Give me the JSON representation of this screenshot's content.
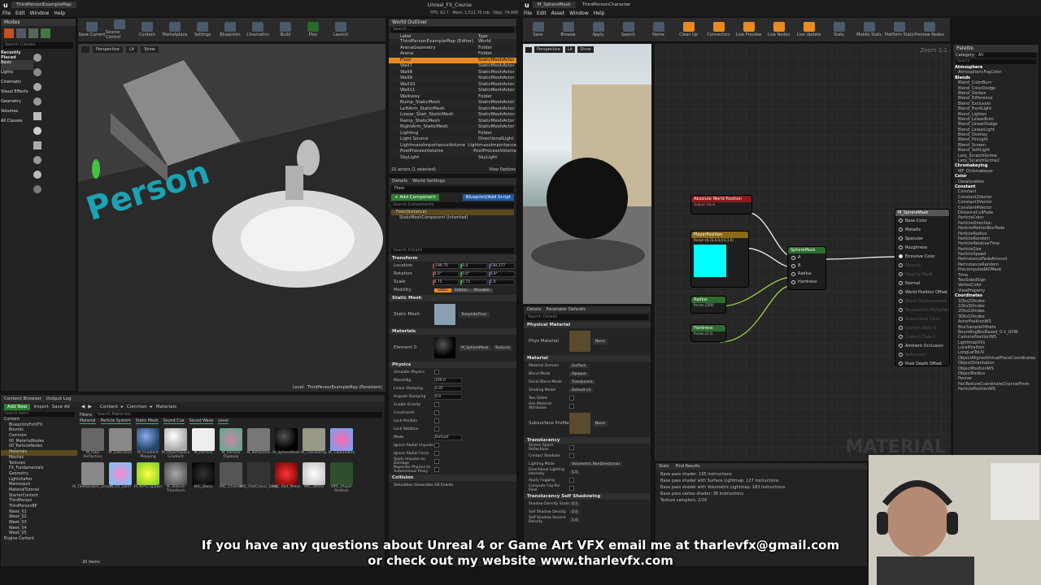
{
  "left_window": {
    "tab": "ThirdPersonExampleMap",
    "app_title": "Unreal_FX_Course",
    "menu": [
      "File",
      "Edit",
      "Window",
      "Help"
    ],
    "stats": "FPS: 62.7 · Mem: 1,511.70 mb · Objs: 74,999",
    "modes_label": "Modes",
    "toolbar": [
      "Save Current",
      "Source Control",
      "Content",
      "Marketplace",
      "Settings",
      "Blueprints",
      "Cinematics",
      "Build",
      "Play",
      "Launch"
    ],
    "search_placeholder": "Search Classes",
    "categories": [
      "Recently Placed",
      "Basic",
      "Lights",
      "Cinematic",
      "Visual Effects",
      "Geometry",
      "Volumes",
      "All Classes"
    ],
    "viewport": {
      "perspective": "Perspective",
      "lit": "Lit",
      "show": "Show",
      "level_label": "Level:",
      "level_name": "ThirdPersonExampleMap (Persistent)",
      "floor_text": "Person"
    },
    "outliner": {
      "title": "World Outliner",
      "search": "Search...",
      "col_label": "Label",
      "col_type": "Type",
      "rows": [
        [
          "ThirdPersonExampleMap (Editor)",
          "World"
        ],
        [
          "ArenaGeometry",
          "Folder"
        ],
        [
          "Arena",
          "Folder"
        ],
        [
          "Floor",
          "StaticMeshActor"
        ],
        [
          "Wall7",
          "StaticMeshActor"
        ],
        [
          "Wall8",
          "StaticMeshActor"
        ],
        [
          "Wall9",
          "StaticMeshActor"
        ],
        [
          "Wall10",
          "StaticMeshActor"
        ],
        [
          "Wall11",
          "StaticMeshActor"
        ],
        [
          "Walkway",
          "Folder"
        ],
        [
          "Bump_StaticMesh",
          "StaticMeshActor"
        ],
        [
          "LeftArm_StaticMesh",
          "StaticMeshActor"
        ],
        [
          "Linear_Stair_StaticMesh",
          "StaticMeshActor"
        ],
        [
          "Ramp_StaticMesh",
          "StaticMeshActor"
        ],
        [
          "RightArm_StaticMesh",
          "StaticMeshActor"
        ],
        [
          "Lighting",
          "Folder"
        ],
        [
          "Light Source",
          "DirectionalLight"
        ],
        [
          "LightmassImportanceVolume",
          "LightmassImportance"
        ],
        [
          "PostProcessVolume",
          "PostProcessVolume"
        ],
        [
          "SkyLight",
          "SkyLight"
        ]
      ],
      "count": "22 actors (1 selected)",
      "view_options": "View Options"
    },
    "details": {
      "tab1": "Details",
      "tab2": "World Settings",
      "name": "Floor",
      "add_component": "+ Add Component",
      "blueprint": "Blueprint/Add Script",
      "search_components": "Search Components",
      "instance": "Floor(Instance)",
      "component": "StaticMeshComponent (Inherited)",
      "search_details": "Search Details",
      "transform": "Transform",
      "location": "Location",
      "loc": [
        "-199.75",
        "0.0",
        "130.277"
      ],
      "rotation": "Rotation",
      "rot": [
        "0.0°",
        "0.0°",
        "0.0°"
      ],
      "scale": "Scale",
      "scl": [
        "0.75",
        "0.75",
        "1.0"
      ],
      "mobility": "Mobility",
      "mob": [
        "Static",
        "Station",
        "Movable"
      ],
      "static_mesh_sec": "Static Mesh",
      "static_mesh": "Static Mesh",
      "mesh_val": "TemplateFloor",
      "materials_sec": "Materials",
      "element0": "Element 0",
      "mat_val": "M_SphereMask",
      "textures": "Textures",
      "physics_sec": "Physics",
      "phys": [
        "Simulate Physics",
        "MassInKg",
        "Linear Damping",
        "Angular Damping",
        "Enable Gravity",
        "Constraints",
        "Lock Position",
        "Lock Rotation",
        "Mode",
        "Ignore Radial Impulse",
        "Ignore Radial Force",
        "Apply Impulse on Damage",
        "Replicate Physics to Autonomous Proxy"
      ],
      "phys_vals": [
        "",
        "100.0",
        "0.01",
        "0.0",
        "",
        "",
        "",
        "",
        "Default"
      ],
      "collision_sec": "Collision",
      "sim_gen": "Simulation Generates Hit Events"
    }
  },
  "bottom": {
    "cb_tab": "Content Browser",
    "log_tab": "Output Log",
    "add_new": "Add New",
    "import": "Import",
    "save_all": "Save All",
    "path": [
      "Content",
      "Common",
      "Materials"
    ],
    "search_paths": "Search Paths",
    "filters": "Filters",
    "search_materials": "Search Materials",
    "filter_tags": [
      "Material",
      "Particle System",
      "Static Mesh",
      "Sound Cue",
      "Sound Wave",
      "Level"
    ],
    "folders": [
      "Content",
      "BlueprintsForVFX",
      "Bounds",
      "Common",
      "00_MaterialNodes",
      "00_ParticleNodes",
      "Materials",
      "Meshes",
      "Textures",
      "FX_Fundamentals",
      "Geometry",
      "Lightshafter",
      "Mannequin",
      "MaterialTutorial",
      "StarterContent",
      "ThirdPerson",
      "ThirdPersonBP",
      "Week_01",
      "Week_02",
      "Week_03",
      "Week_04",
      "Week_05",
      "Engine Content"
    ],
    "assets": [
      "M_Fake Refraction",
      "M_FlatColour",
      "M_Gradient Mapping",
      "M_ObjectSpace Gradient",
      "M_Particle",
      "M_Particle Flipbook",
      "M_Refraction",
      "M_SphereMask",
      "M_TileOverlay",
      "M_TileRandom",
      "M_TileRandom_2mask",
      "M_UV_Swirl",
      "M_WPO_Spawn",
      "M_Texture Transform",
      "MIC_Black",
      "MIC_Chrome",
      "MIC_FlatColour_Dark",
      "MIC_Red_Metal",
      "MIC_White",
      "MPC_Player Position"
    ],
    "item_count": "20 items"
  },
  "right_window": {
    "tab1": "M_SphereMask",
    "tab2": "ThirdPersonCharacter",
    "menu": [
      "File",
      "Edit",
      "Asset",
      "Window",
      "Help"
    ],
    "toolbar": [
      "Save",
      "Browse",
      "Apply",
      "Search",
      "Home",
      "Clean Up",
      "Connectors",
      "Live Preview",
      "Live Nodes",
      "Live Update",
      "Stats",
      "Mobile Stats",
      "Platform Stats",
      "Preview Nodes"
    ],
    "preview": {
      "perspective": "Perspective",
      "lit": "Lit",
      "show": "Show"
    },
    "graph": {
      "zoom": "Zoom 1:1",
      "watermark": "MATERIAL",
      "n_awp": "Absolute World Position",
      "n_awp_sub": "Output Value",
      "n_pp": "PlayerPosition",
      "n_pp_sub": "Param (0.23,0.0,0.0,1.0)",
      "n_radius": "Radius",
      "n_radius_sub": "Param (200)",
      "n_hardness": "Hardness",
      "n_hardness_sub": "Param (0.5)",
      "n_sphere": "SphereMask",
      "sphere_pins": [
        "A",
        "B",
        "Radius",
        "Hardness"
      ],
      "n_result": "M_SphereMask",
      "result_pins": [
        "Base Color",
        "Metallic",
        "Specular",
        "Roughness",
        "Emissive Color",
        "Opacity",
        "Opacity Mask",
        "Normal",
        "World Position Offset",
        "World Displacement",
        "Tessellation Multiplier",
        "Subsurface Color",
        "Custom Data 0",
        "Custom Data 1",
        "Ambient Occlusion",
        "Refraction",
        "Pixel Depth Offset"
      ]
    },
    "details": {
      "tab1": "Details",
      "tab2": "Parameter Defaults",
      "search": "Search Details",
      "phys_mat_sec": "Physical Material",
      "phys_mat": "Phys Material",
      "none": "None",
      "material_sec": "Material",
      "rows": [
        [
          "Material Domain",
          "Surface"
        ],
        [
          "Blend Mode",
          "Opaque"
        ],
        [
          "Decal Blend Mode",
          "Translucent"
        ],
        [
          "Shading Model",
          "Default Lit"
        ],
        [
          "Two Sided",
          ""
        ],
        [
          "Use Material Attributes",
          ""
        ]
      ],
      "subsurface": "Subsurface Profile",
      "translucency_sec": "Translucency",
      "trans_rows": [
        "Screen Space Reflections",
        "Contact Shadows",
        "Lighting Mode",
        "Directional Lighting Intensity",
        "Apply Fogging",
        "Compute Fog Per Pixel"
      ],
      "lighting_mode": "Volumetric NonDirectional",
      "dir_val": "1.0",
      "tss_sec": "Translucency Self Shadowing",
      "tss_rows": [
        "Shadow Density Scale",
        "Self Shadow Density",
        "Self Shadow Second Density"
      ],
      "tss_vals": [
        "0.5",
        "2.0",
        "1.0"
      ]
    },
    "stats": {
      "tab1": "Stats",
      "tab2": "Find Results",
      "lines": [
        "Base pass shader: 105 instructions",
        "Base pass shader with Surface Lightmap: 127 instructions",
        "Base pass shader with Volumetric Lightmap: 183 instructions",
        "Base pass vertex shader: 36 instructions",
        "Texture samplers: 2/16"
      ]
    },
    "palette": {
      "title": "Palette",
      "category": "Category",
      "category_val": "All",
      "search": "Search",
      "items": [
        [
          "c",
          "Atmosphere"
        ],
        [
          "",
          "AtmosphericFogColor"
        ],
        [
          "c",
          "Blends"
        ],
        [
          "",
          "Blend_ColorBurn"
        ],
        [
          "",
          "Blend_ColorDodge"
        ],
        [
          "",
          "Blend_Darken"
        ],
        [
          "",
          "Blend_Difference"
        ],
        [
          "",
          "Blend_Exclusion"
        ],
        [
          "",
          "Blend_HardLight"
        ],
        [
          "",
          "Blend_Lighten"
        ],
        [
          "",
          "Blend_LinearBurn"
        ],
        [
          "",
          "Blend_LinearDodge"
        ],
        [
          "",
          "Blend_LinearLight"
        ],
        [
          "",
          "Blend_Overlay"
        ],
        [
          "",
          "Blend_PinLight"
        ],
        [
          "",
          "Blend_Screen"
        ],
        [
          "",
          "Blend_SoftLight"
        ],
        [
          "",
          "Lerp_ScratchGrime"
        ],
        [
          "",
          "Lerp_ScratchGrime2"
        ],
        [
          "c",
          "Chromakeying"
        ],
        [
          "",
          "MF_Chromakeyer"
        ],
        [
          "c",
          "Color"
        ],
        [
          "",
          "Desaturation"
        ],
        [
          "c",
          "Constant"
        ],
        [
          "",
          "Constant"
        ],
        [
          "",
          "Constant2Vector"
        ],
        [
          "",
          "Constant3Vector"
        ],
        [
          "",
          "Constant4Vector"
        ],
        [
          "",
          "DistanceCullFade"
        ],
        [
          "",
          "ParticleColor"
        ],
        [
          "",
          "ParticleDirection"
        ],
        [
          "",
          "ParticleMotionBlurFade"
        ],
        [
          "",
          "ParticleRadius"
        ],
        [
          "",
          "ParticleRandom"
        ],
        [
          "",
          "ParticleRelativeTime"
        ],
        [
          "",
          "ParticleSize"
        ],
        [
          "",
          "ParticleSpeed"
        ],
        [
          "",
          "PerInstanceFadeAmount"
        ],
        [
          "",
          "PerInstanceRandom"
        ],
        [
          "",
          "PrecomputedAOMask"
        ],
        [
          "",
          "Time"
        ],
        [
          "",
          "TwoSidedSign"
        ],
        [
          "",
          "VertexColor"
        ],
        [
          "",
          "ViewProperty"
        ],
        [
          "c",
          "Coordinates"
        ],
        [
          "",
          "1Dto2DIndex"
        ],
        [
          "",
          "1Dto3DIndex"
        ],
        [
          "",
          "2Dto1DIndex"
        ],
        [
          "",
          "3Dto1DIndex"
        ],
        [
          "",
          "ActorPositionWS"
        ],
        [
          "",
          "BlurSampleOffsets"
        ],
        [
          "",
          "BoundingBoxBased_0-1_UVW"
        ],
        [
          "",
          "CameraPositionWS"
        ],
        [
          "",
          "LightmapUVs"
        ],
        [
          "",
          "LocalPosition"
        ],
        [
          "",
          "LongLatToUV"
        ],
        [
          "",
          "ObjectAlignedVirtualPlaneCoordinates"
        ],
        [
          "",
          "ObjectOrientation"
        ],
        [
          "",
          "ObjectPositionWS"
        ],
        [
          "",
          "ObjectRadius"
        ],
        [
          "",
          "Panner"
        ],
        [
          "",
          "PanTextureCoordinateChannelFrom"
        ],
        [
          "",
          "ParticlePositionWS"
        ]
      ]
    }
  },
  "subtitle": {
    "line1": "If you have any questions about Unreal 4 or Game Art VFX email me at tharlevfx@gmail.com",
    "line2": "or check out my website www.tharlevfx.com"
  },
  "colors": {
    "accent": "#e88a1e",
    "brand_green": "#2e7d32",
    "selected": "#5a4a1e",
    "node_red": "#8b1a1a",
    "node_green": "#2e6b2e",
    "node_gold": "#8a6a1a",
    "cyan": "#00ffff"
  }
}
